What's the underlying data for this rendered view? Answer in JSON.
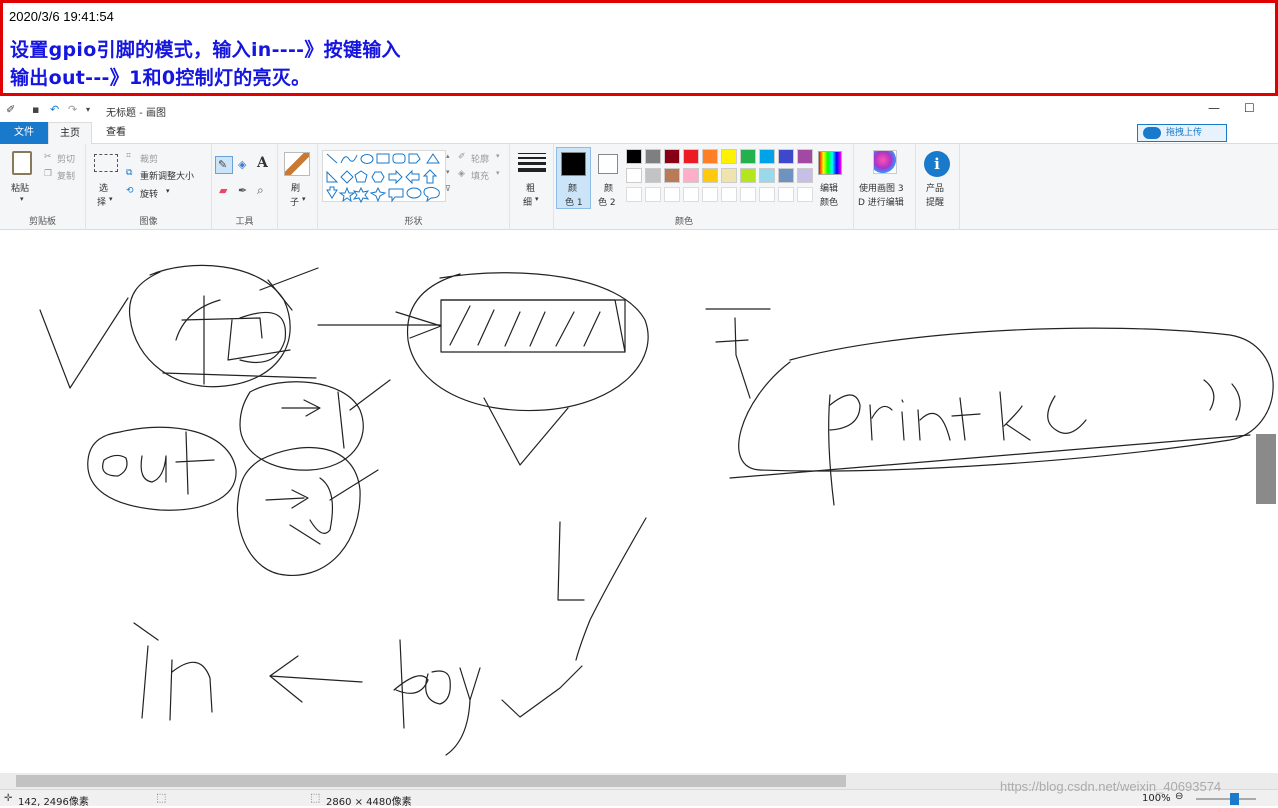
{
  "note": {
    "timestamp": "2020/3/6 19:41:54",
    "line1": "设置gpio引脚的模式，输入in----》按键输入",
    "line2": "输出out---》1和0控制灯的亮灭。"
  },
  "window": {
    "title": "无标题 - 画图",
    "minimize": "—",
    "maximize": "☐"
  },
  "tabs": {
    "file": "文件",
    "home": "主页",
    "view": "查看"
  },
  "share_button": "拖拽上传",
  "ribbon": {
    "clipboard": {
      "group": "剪贴板",
      "paste": "粘贴",
      "cut": "剪切",
      "copy": "复制"
    },
    "image": {
      "group": "图像",
      "select": "选\n择",
      "select_1": "选",
      "select_2": "择",
      "crop": "裁剪",
      "resize": "重新调整大小",
      "rotate": "旋转"
    },
    "tools": {
      "group": "工具"
    },
    "brushes": {
      "label_1": "刷",
      "label_2": "子"
    },
    "shapes": {
      "group": "形状",
      "outline": "轮廓",
      "fill": "填充"
    },
    "size": {
      "label_1": "粗",
      "label_2": "细"
    },
    "colors": {
      "group": "颜色",
      "color1_1": "颜",
      "color1_2": "色 1",
      "color2_1": "颜",
      "color2_2": "色 2",
      "edit_1": "编辑",
      "edit_2": "颜色",
      "row1": [
        "#000000",
        "#7f7f7f",
        "#880015",
        "#ed1c24",
        "#ff7f27",
        "#fff200",
        "#22b14c",
        "#00a2e8",
        "#3f48cc",
        "#a349a4"
      ],
      "row2": [
        "#ffffff",
        "#c3c3c3",
        "#b97a57",
        "#ffaec9",
        "#ffc90e",
        "#efe4b0",
        "#b5e61d",
        "#99d9ea",
        "#7092be",
        "#c8bfe7"
      ],
      "row3": [
        "#ffffff",
        "#ffffff",
        "#ffffff",
        "#ffffff",
        "#ffffff",
        "#ffffff",
        "#ffffff",
        "#ffffff",
        "#ffffff",
        "#ffffff"
      ]
    },
    "paint3d": {
      "line1": "使用画图 3",
      "line2": "D 进行编辑"
    },
    "product": {
      "line1": "产品",
      "line2": "提醒"
    }
  },
  "status": {
    "cursor": "142, 2496像素",
    "size": "2860 × 4480像素",
    "zoom": "100%"
  },
  "watermark": "https://blog.csdn.net/weixin_40693574"
}
